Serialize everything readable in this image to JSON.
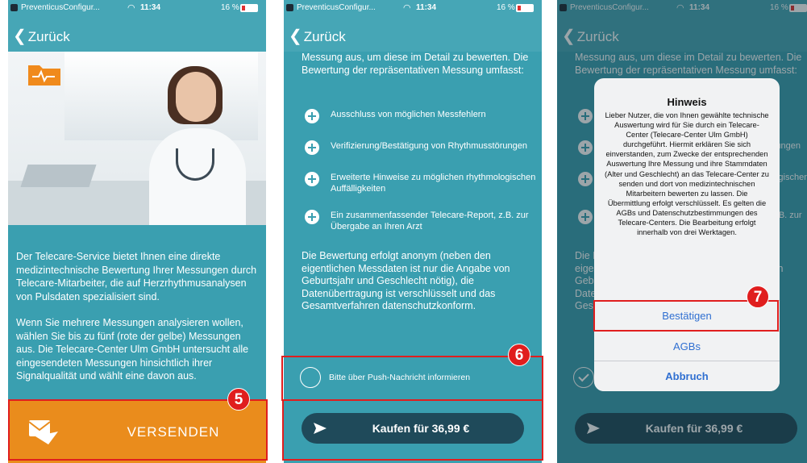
{
  "statusbar": {
    "carrier": "PreventicusConfigur...",
    "time": "11:34",
    "battery": "16 %"
  },
  "nav": {
    "back_label": "Zurück"
  },
  "screen1": {
    "paragraphs": [
      "Der Telecare-Service bietet Ihnen eine direkte medizintechnische Bewertung Ihrer Messungen durch Telecare-Mitarbeiter, die auf Herzrhythmusanalysen von Pulsdaten spezialisiert sind.",
      "Wenn Sie mehrere Messungen analysieren wollen, wählen Sie bis zu fünf (rote der gelbe) Messungen aus. Die Telecare-Center Ulm GmbH untersucht alle eingesendeten Messungen hinsichtlich ihrer Signalqualität und wählt eine davon aus."
    ],
    "send_label": "VERSENDEN",
    "send_color": "#ea8c1c"
  },
  "screen2": {
    "intro": "Messung aus, um diese im Detail zu bewerten. Die Bewertung der repräsentativen Messung umfasst:",
    "features": [
      "Ausschluss von möglichen Messfehlern",
      "Verifizierung/Bestätigung von Rhythmusstörungen",
      "Erweiterte Hinweise  zu möglichen rhythmologischen Auffälligkeiten",
      "Ein zusammenfassender Telecare-Report, z.B. zur Übergabe an Ihren Arzt"
    ],
    "description": "Die Bewertung erfolgt anonym (neben den eigentlichen Messdaten ist nur die Angabe von Geburtsjahr und Geschlecht nötig), die Datenübertragung ist verschlüsselt und das Gesamtverfahren datenschutzkonform.",
    "push_label": "Bitte über Push-Nachricht informieren",
    "buy_label": "Kaufen für 36,99 €"
  },
  "dialog": {
    "title": "Hinweis",
    "message": "Lieber Nutzer, die von Ihnen gewählte technische Auswertung wird für Sie durch ein Telecare-Center (Telecare-Center Ulm GmbH) durchgeführt. Hiermit erklären Sie sich einverstanden, zum Zwecke der entsprechenden Auswertung Ihre Messung und ihre Stammdaten (Alter und Geschlecht) an das Telecare-Center zu senden und dort von medizintechnischen Mitarbeitern bewerten zu lassen. Die Übermittlung erfolgt verschlüsselt. Es gelten die AGBs und Datenschutzbestimmungen des Telecare-Centers. Die Bearbeitung erfolgt innerhalb von drei Werktagen.",
    "confirm_label": "Bestätigen",
    "agb_label": "AGBs",
    "cancel_label": "Abbruch"
  },
  "annotations": {
    "step5": "5",
    "step6": "6",
    "step7": "7",
    "color": "#e01e1e"
  },
  "colors": {
    "background": "#3a9fb0",
    "header": "#46a6b6",
    "button_dark": "#1f4a5a",
    "link_blue": "#2f6fd1"
  },
  "icons": [
    "folder-heart-icon",
    "mail-send-icon",
    "plus-circle-icon",
    "send-arrow-icon",
    "wifi-icon",
    "battery-icon",
    "chevron-left-icon"
  ]
}
